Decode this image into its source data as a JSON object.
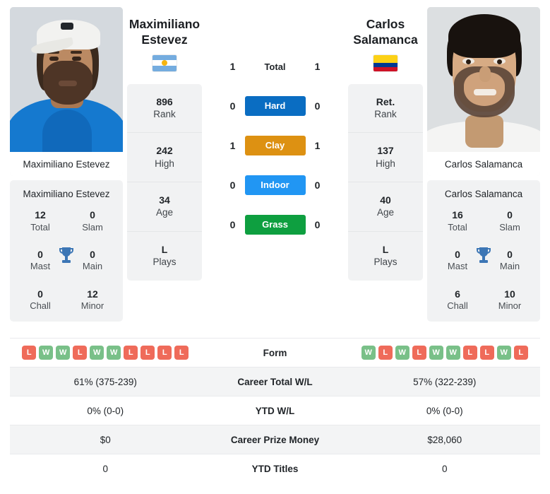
{
  "players": {
    "left": {
      "name": "Maximiliano Estevez",
      "name_line1": "Maximiliano",
      "name_line2": "Estevez",
      "flag": "argentina-flag",
      "photo_caption": "Maximiliano Estevez",
      "info": [
        {
          "value": "896",
          "label": "Rank"
        },
        {
          "value": "242",
          "label": "High"
        },
        {
          "value": "34",
          "label": "Age"
        },
        {
          "value": "L",
          "label": "Plays"
        }
      ],
      "titles": [
        {
          "value": "12",
          "label": "Total"
        },
        {
          "value": "0",
          "label": "Slam"
        },
        {
          "value": "0",
          "label": "Mast"
        },
        {
          "value": "0",
          "label": "Main"
        },
        {
          "value": "0",
          "label": "Chall"
        },
        {
          "value": "12",
          "label": "Minor"
        }
      ],
      "form": [
        "L",
        "W",
        "W",
        "L",
        "W",
        "W",
        "L",
        "L",
        "L",
        "L"
      ],
      "career_total_wl": "61% (375-239)",
      "ytd_wl": "0% (0-0)",
      "career_prize_money": "$0",
      "ytd_titles": "0"
    },
    "right": {
      "name": "Carlos Salamanca",
      "name_line1": "Carlos",
      "name_line2": "Salamanca",
      "flag": "colombia-flag",
      "photo_caption": "Carlos Salamanca",
      "info": [
        {
          "value": "Ret.",
          "label": "Rank"
        },
        {
          "value": "137",
          "label": "High"
        },
        {
          "value": "40",
          "label": "Age"
        },
        {
          "value": "L",
          "label": "Plays"
        }
      ],
      "titles": [
        {
          "value": "16",
          "label": "Total"
        },
        {
          "value": "0",
          "label": "Slam"
        },
        {
          "value": "0",
          "label": "Mast"
        },
        {
          "value": "0",
          "label": "Main"
        },
        {
          "value": "6",
          "label": "Chall"
        },
        {
          "value": "10",
          "label": "Minor"
        }
      ],
      "form": [
        "W",
        "L",
        "W",
        "L",
        "W",
        "W",
        "L",
        "L",
        "W",
        "L"
      ],
      "career_total_wl": "57% (322-239)",
      "ytd_wl": "0% (0-0)",
      "career_prize_money": "$28,060",
      "ytd_titles": "0"
    }
  },
  "surfaces": [
    {
      "label": "Total",
      "left": "1",
      "right": "1",
      "color": "",
      "pill": false
    },
    {
      "label": "Hard",
      "left": "0",
      "right": "0",
      "color": "#0a6dc2",
      "pill": true
    },
    {
      "label": "Clay",
      "left": "1",
      "right": "1",
      "color": "#dd9112",
      "pill": true
    },
    {
      "label": "Indoor",
      "left": "0",
      "right": "0",
      "color": "#2196f3",
      "pill": true
    },
    {
      "label": "Grass",
      "left": "0",
      "right": "0",
      "color": "#0e9f40",
      "pill": true
    }
  ],
  "table_rows": [
    {
      "label": "Form",
      "type": "form",
      "left": "",
      "right": ""
    },
    {
      "label": "Career Total W/L",
      "type": "text",
      "left": "61% (375-239)",
      "right": "57% (322-239)"
    },
    {
      "label": "YTD W/L",
      "type": "text",
      "left": "0% (0-0)",
      "right": "0% (0-0)"
    },
    {
      "label": "Career Prize Money",
      "type": "text",
      "left": "$0",
      "right": "$28,060"
    },
    {
      "label": "YTD Titles",
      "type": "text",
      "left": "0",
      "right": "0"
    }
  ],
  "icons": {
    "trophy": "trophy-icon"
  },
  "colors": {
    "win": "#79c088",
    "loss": "#ef6b5a",
    "card_bg": "#f1f2f3",
    "row_alt": "#f3f4f5"
  }
}
